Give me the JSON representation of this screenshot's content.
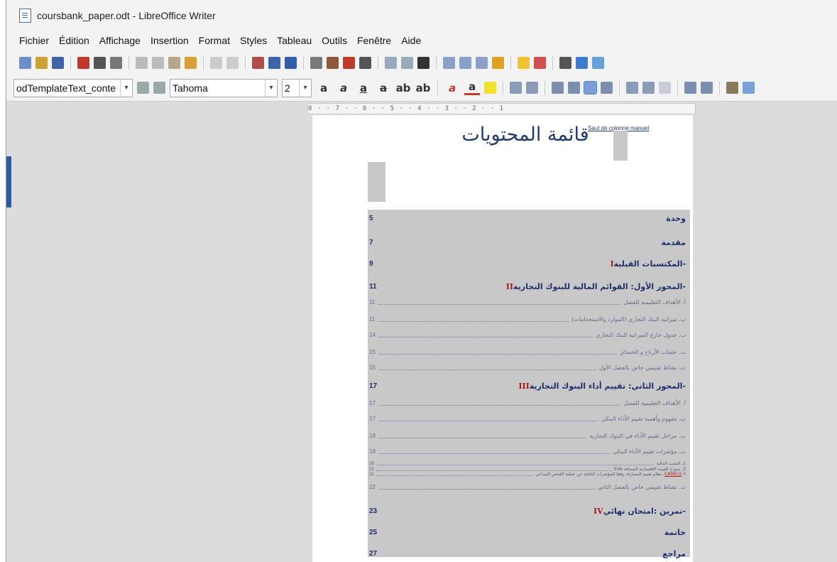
{
  "window": {
    "title": "coursbank_paper.odt - LibreOffice Writer"
  },
  "menubar": [
    "Fichier",
    "Édition",
    "Affichage",
    "Insertion",
    "Format",
    "Styles",
    "Tableau",
    "Outils",
    "Fenêtre",
    "Aide"
  ],
  "format_bar": {
    "style_value": "odTemplateText_conte",
    "font_value": "Tahoma",
    "size_value": "2"
  },
  "ruler_text": "8 · · 7 · · 6 · · 5 · · 4 · · 3 · · 2 · · 1",
  "document": {
    "title": "قائمة المحتويات",
    "column_break_label": "Saut de colonne manuel",
    "toc": [
      {
        "num": "5",
        "label": "وحدة",
        "level": "main"
      },
      {
        "num": "7",
        "label": "مقدمة",
        "level": "main"
      },
      {
        "num": "9",
        "roman": "I",
        "label": "-المكتسبات القبلية",
        "level": "main"
      },
      {
        "num": "11",
        "roman": "II",
        "label": "-المحور الأول: القوائم المالية للبنوك التجارية",
        "level": "main"
      },
      {
        "num": "11",
        "label": "أ. الأهداف التعليمية للفصل",
        "level": "sub"
      },
      {
        "num": "11",
        "label": "ب. ميزانية البنك التجاري (الموارد والاستخدامات)",
        "level": "sub"
      },
      {
        "num": "14",
        "label": "ب. جدول خارج الميزانية للبنك التجاري",
        "level": "sub"
      },
      {
        "num": "15",
        "label": "ت. حساب الأرباح و الخسائر",
        "level": "sub"
      },
      {
        "num": "15",
        "label": "ث. نشاط تقييمي خاص بالفصل الأول",
        "level": "sub"
      },
      {
        "num": "17",
        "roman": "III",
        "label": "-المحور الثاني: تقييم أداء البنوك التجارية",
        "level": "main"
      },
      {
        "num": "17",
        "label": "أ. الأهداف التعليمية للفصل",
        "level": "sub"
      },
      {
        "num": "17",
        "label": "ب. مفهوم وأهمية تقييم الأداء البنكي",
        "level": "sub"
      },
      {
        "num": "18",
        "label": "ب. مراحل تقييم الأداء في البنوك التجارية",
        "level": "sub"
      },
      {
        "num": "18",
        "label": "ت. مؤشرات تقييم الأداء البنكي",
        "level": "sub"
      },
      {
        "num": "18",
        "label": "1. النسب المالية",
        "level": "tiny"
      },
      {
        "num": "21",
        "label": "2. نموذج القيمة الاقتصادية المضافة EVA",
        "level": "tiny"
      },
      {
        "num": "21",
        "label": "3. نظام تقييم المصارف وفقا للمؤشرات الناتجة عن عملية الفحص الميداني",
        "camels": "CAMELS",
        "level": "tiny"
      },
      {
        "num": "22",
        "label": "ث. نشاط تقييمي خاص بالفصل الثاني",
        "level": "sub"
      },
      {
        "num": "23",
        "roman": "IV",
        "label": "-تمرين :امتحان نهائي",
        "level": "main"
      },
      {
        "num": "25",
        "label": "خاتمة",
        "level": "main"
      },
      {
        "num": "27",
        "label": "مراجع",
        "level": "main"
      }
    ]
  }
}
